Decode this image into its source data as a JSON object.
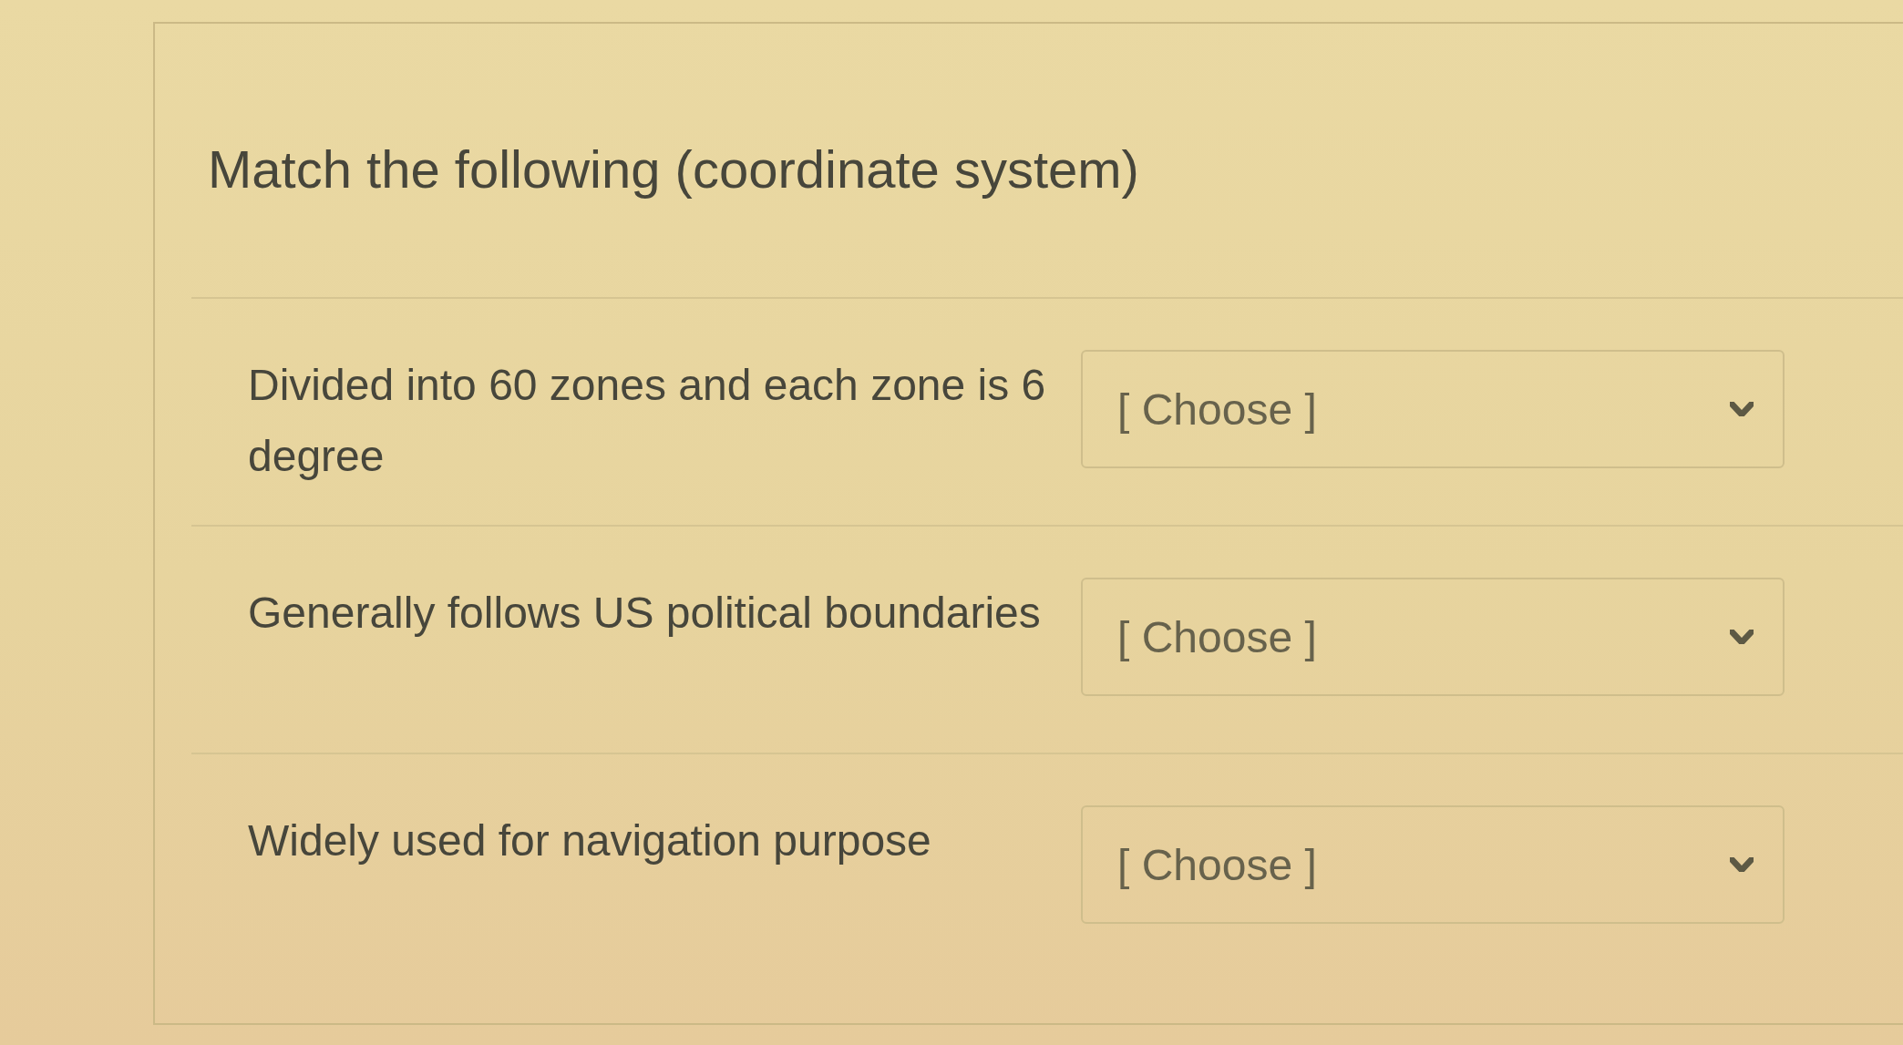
{
  "question": {
    "title": "Match the following (coordinate system)"
  },
  "matches": [
    {
      "prompt": "Divided into 60 zones and each zone is 6 degree",
      "answer": {
        "value": "[ Choose ]"
      }
    },
    {
      "prompt": "Generally follows US political boundaries",
      "answer": {
        "value": "[ Choose ]"
      }
    },
    {
      "prompt": "Widely used for navigation purpose",
      "answer": {
        "value": "[ Choose ]"
      }
    }
  ]
}
